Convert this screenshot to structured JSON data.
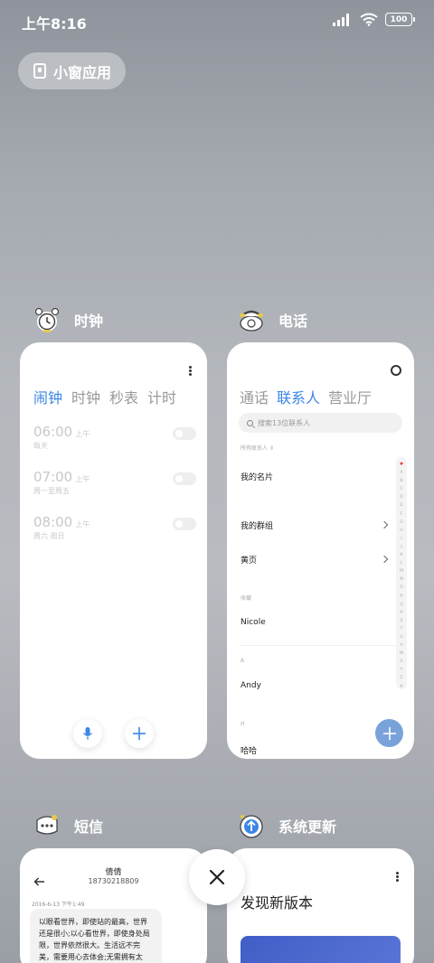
{
  "status_bar": {
    "time": "上午8:16",
    "battery": "100"
  },
  "small_window": {
    "label": "小窗应用"
  },
  "apps": {
    "clock": {
      "title": "时钟",
      "tabs": [
        "闹钟",
        "时钟",
        "秒表",
        "计时"
      ],
      "active_tab": 0,
      "alarms": [
        {
          "time": "06:00",
          "ampm": "上午",
          "repeat": "每天"
        },
        {
          "time": "07:00",
          "ampm": "上午",
          "repeat": "周一至周五"
        },
        {
          "time": "08:00",
          "ampm": "上午",
          "repeat": "周六 周日"
        }
      ]
    },
    "phone": {
      "title": "电话",
      "tabs": [
        "通话",
        "联系人",
        "营业厅"
      ],
      "active_tab": 1,
      "search_placeholder": "搜索13位联系人",
      "filter_label": "所有联系人 ⇕",
      "rows": {
        "my_card": "我的名片",
        "my_groups": "我的群组",
        "yellow_pages": "黄页",
        "favorites_header": "收藏",
        "contact_nicole": "Nicole",
        "header_a": "A",
        "contact_andy": "Andy",
        "header_h": "H",
        "contact_haha": "哈哈"
      },
      "alphabet": [
        "♥",
        "A",
        "B",
        "C",
        "D",
        "E",
        "F",
        "G",
        "H",
        "I",
        "J",
        "K",
        "L",
        "M",
        "N",
        "O",
        "P",
        "Q",
        "R",
        "S",
        "T",
        "U",
        "V",
        "W",
        "X",
        "Y",
        "Z",
        "#"
      ]
    },
    "sms": {
      "title": "短信",
      "contact_name": "倩倩",
      "contact_number": "18730218809",
      "date": "2016-6-13 下午1:49",
      "message": "以眼看世界，即使站的最高，世界还是很小;以心看世界，即使身处局限，世界依然很大。生活远不完美，需要用心去体会;无需拥有太"
    },
    "update": {
      "title": "系统更新",
      "headline": "发现新版本"
    }
  },
  "colors": {
    "accent": "#3b86e6",
    "fab": "#7aa2da"
  }
}
